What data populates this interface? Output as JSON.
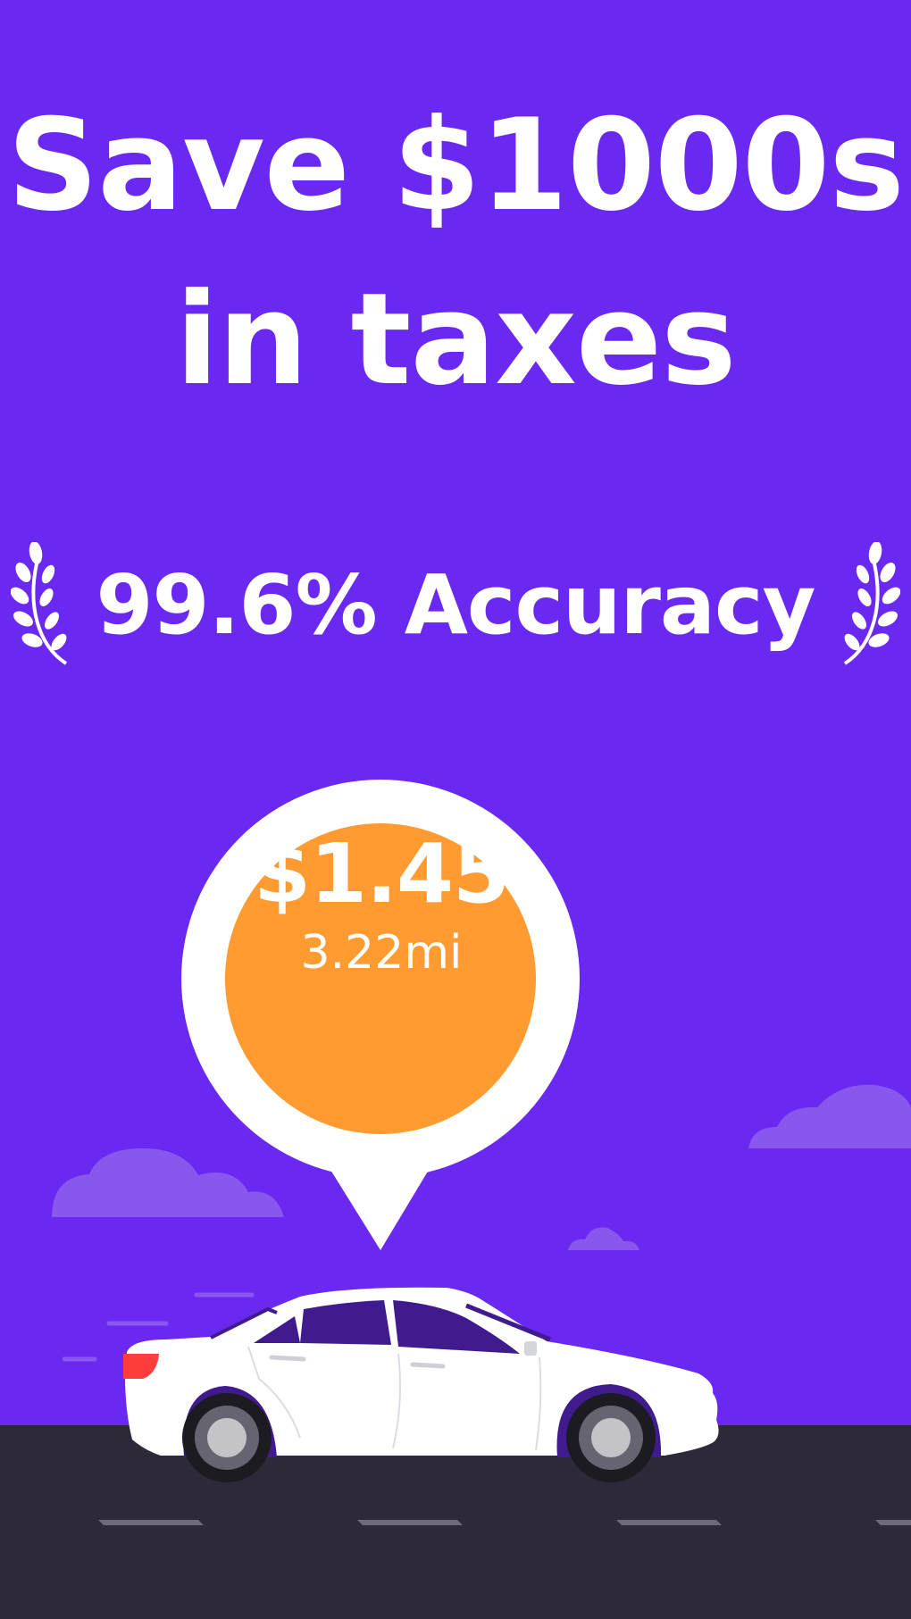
{
  "headline": {
    "line1": "Save $1000s",
    "line2": "in taxes"
  },
  "badge": {
    "text": "99.6% Accuracy",
    "icon_left": "laurel-left-icon",
    "icon_right": "laurel-right-icon"
  },
  "pin": {
    "amount": "$1.45",
    "distance": "3.22mi"
  },
  "colors": {
    "background": "#6a29f0",
    "pin_fill": "#ff9b30",
    "road": "#2e2939",
    "cloud": "#8a57ee",
    "car": "#ffffff",
    "car_window": "#3f1b8d",
    "tail_light": "#ff3d3d"
  }
}
